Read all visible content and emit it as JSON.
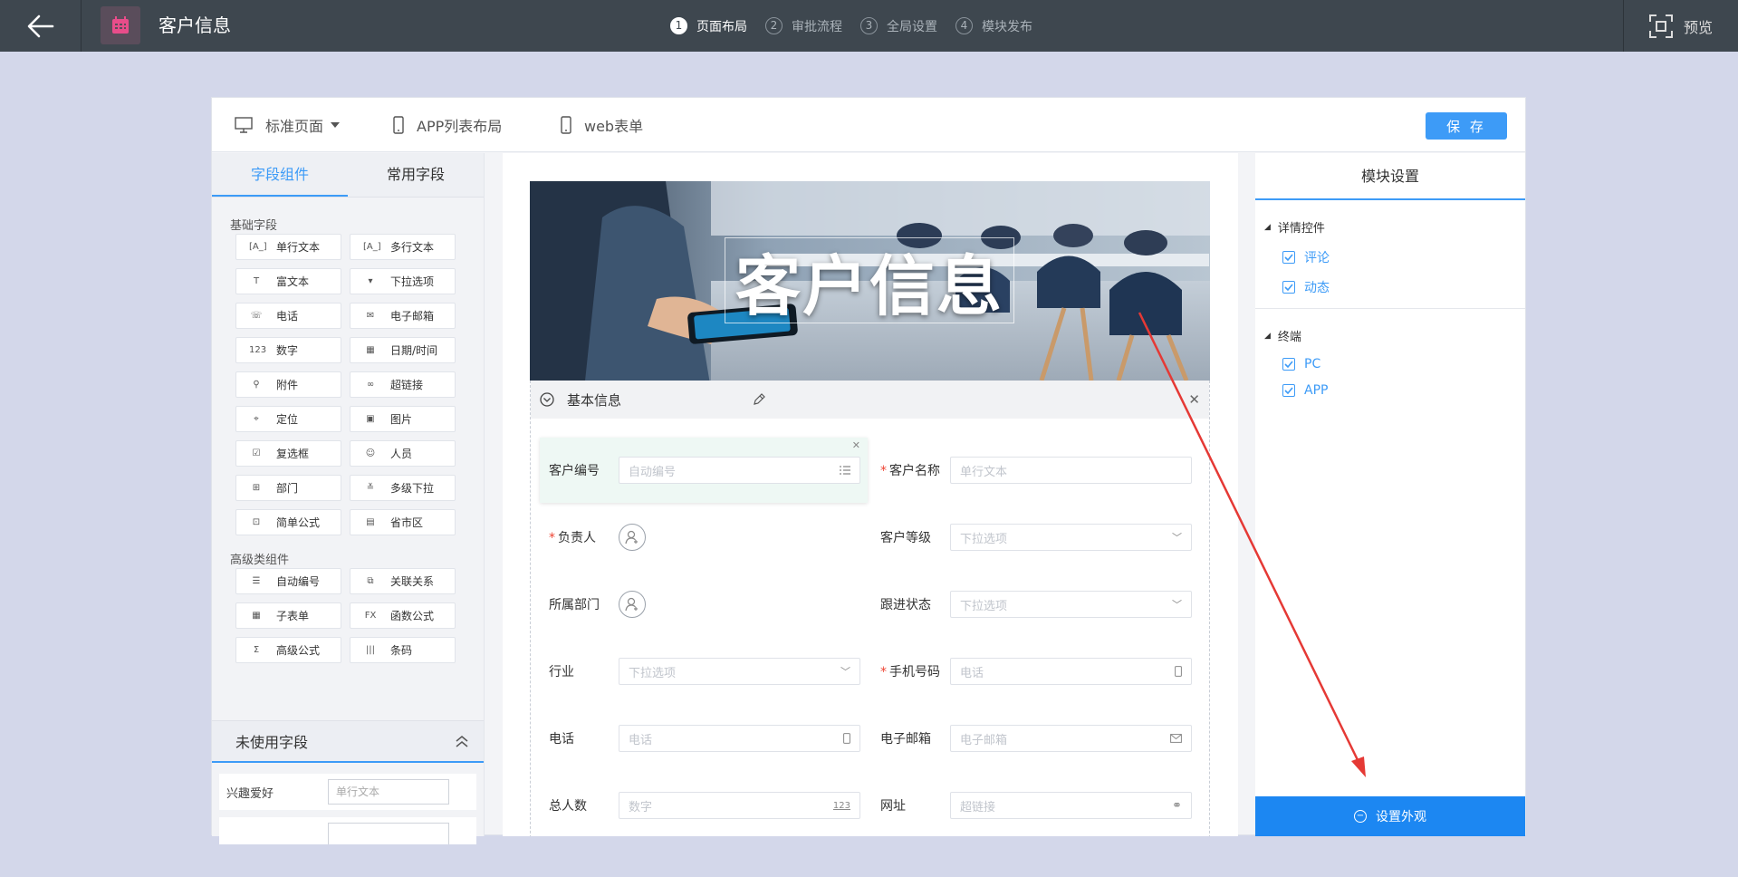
{
  "header": {
    "app_title": "客户信息",
    "steps": [
      {
        "num": "1",
        "label": "页面布局"
      },
      {
        "num": "2",
        "label": "审批流程"
      },
      {
        "num": "3",
        "label": "全局设置"
      },
      {
        "num": "4",
        "label": "模块发布"
      }
    ],
    "preview_label": "预览"
  },
  "view_tabs": {
    "standard": "标准页面",
    "app_list": "APP列表布局",
    "web_form": "web表单",
    "save": "保 存"
  },
  "left_panel": {
    "tabs": [
      "字段组件",
      "常用字段"
    ],
    "basic_title": "基础字段",
    "basic_fields": [
      {
        "icon": "[A_]",
        "label": "单行文本"
      },
      {
        "icon": "[A_]",
        "label": "多行文本"
      },
      {
        "icon": "T",
        "label": "富文本"
      },
      {
        "icon": "▾",
        "label": "下拉选项"
      },
      {
        "icon": "☏",
        "label": "电话"
      },
      {
        "icon": "✉",
        "label": "电子邮箱"
      },
      {
        "icon": "123",
        "label": "数字"
      },
      {
        "icon": "▦",
        "label": "日期/时间"
      },
      {
        "icon": "⚲",
        "label": "附件"
      },
      {
        "icon": "∞",
        "label": "超链接"
      },
      {
        "icon": "⌖",
        "label": "定位"
      },
      {
        "icon": "▣",
        "label": "图片"
      },
      {
        "icon": "☑",
        "label": "复选框"
      },
      {
        "icon": "☺",
        "label": "人员"
      },
      {
        "icon": "⊞",
        "label": "部门"
      },
      {
        "icon": "≚",
        "label": "多级下拉"
      },
      {
        "icon": "⊡",
        "label": "简单公式"
      },
      {
        "icon": "▤",
        "label": "省市区"
      }
    ],
    "advanced_title": "高级类组件",
    "advanced_fields": [
      {
        "icon": "☰",
        "label": "自动编号"
      },
      {
        "icon": "⧉",
        "label": "关联关系"
      },
      {
        "icon": "▦",
        "label": "子表单"
      },
      {
        "icon": "FX",
        "label": "函数公式"
      },
      {
        "icon": "Σ",
        "label": "高级公式"
      },
      {
        "icon": "|||",
        "label": "条码"
      }
    ],
    "unused_title": "未使用字段",
    "unused_fields": [
      {
        "label": "兴趣爱好",
        "placeholder": "单行文本"
      }
    ]
  },
  "canvas": {
    "banner_text": "客户信息",
    "section_title": "基本信息",
    "fields": {
      "cust_no": {
        "label": "客户编号",
        "placeholder": "自动编号"
      },
      "cust_name": {
        "label": "客户名称",
        "placeholder": "单行文本"
      },
      "owner": {
        "label": "负责人"
      },
      "level": {
        "label": "客户等级",
        "placeholder": "下拉选项"
      },
      "dept": {
        "label": "所属部门"
      },
      "follow": {
        "label": "跟进状态",
        "placeholder": "下拉选项"
      },
      "industry": {
        "label": "行业",
        "placeholder": "下拉选项"
      },
      "mobile": {
        "label": "手机号码",
        "placeholder": "电话"
      },
      "phone": {
        "label": "电话",
        "placeholder": "电话"
      },
      "email": {
        "label": "电子邮箱",
        "placeholder": "电子邮箱"
      },
      "total": {
        "label": "总人数",
        "placeholder": "数字",
        "suffix": "123"
      },
      "website": {
        "label": "网址",
        "placeholder": "超链接"
      }
    }
  },
  "right_panel": {
    "title": "模块设置",
    "detail_group": "详情控件",
    "detail_items": [
      "评论",
      "动态"
    ],
    "terminal_group": "终端",
    "terminal_items": [
      "PC",
      "APP"
    ],
    "appearance_button": "设置外观"
  },
  "colors": {
    "accent": "#3d9bf7",
    "topbar": "#3e474f",
    "background": "#d3d7ea",
    "arrow": "#e53935"
  }
}
